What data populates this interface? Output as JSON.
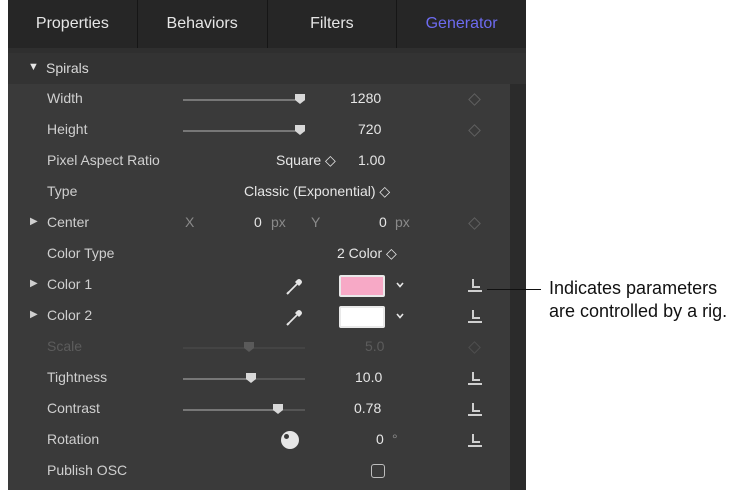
{
  "tabs": [
    {
      "label": "Properties",
      "active": false
    },
    {
      "label": "Behaviors",
      "active": false
    },
    {
      "label": "Filters",
      "active": false
    },
    {
      "label": "Generator",
      "active": true
    }
  ],
  "section": {
    "label": "Spirals",
    "expanded": true
  },
  "params": {
    "width": {
      "label": "Width",
      "value": "1280"
    },
    "height": {
      "label": "Height",
      "value": "720"
    },
    "par": {
      "label": "Pixel Aspect Ratio",
      "mode": "Square",
      "value": "1.00"
    },
    "type": {
      "label": "Type",
      "value": "Classic (Exponential)"
    },
    "center": {
      "label": "Center",
      "x_label": "X",
      "x_value": "0",
      "y_label": "Y",
      "y_value": "0",
      "unit": "px"
    },
    "color_type": {
      "label": "Color Type",
      "value": "2 Color"
    },
    "color1": {
      "label": "Color 1",
      "color": "#f7a9c6"
    },
    "color2": {
      "label": "Color 2",
      "color": "#ffffff"
    },
    "scale": {
      "label": "Scale",
      "value": "5.0",
      "disabled": true
    },
    "tightness": {
      "label": "Tightness",
      "value": "10.0"
    },
    "contrast": {
      "label": "Contrast",
      "value": "0.78"
    },
    "rotation": {
      "label": "Rotation",
      "value": "0",
      "unit": "°"
    },
    "publish_osc": {
      "label": "Publish OSC",
      "checked": false
    }
  },
  "updown_glyph": "◇",
  "callout": {
    "line1": "Indicates parameters",
    "line2": "are controlled by a rig."
  },
  "colors": {
    "accent": "#6d6bf0",
    "panel": "#3a3a3a",
    "tabbar": "#262626"
  },
  "icons": [
    "disclosure-triangle-icon",
    "keyframe-diamond-icon",
    "rig-icon",
    "eyedropper-icon",
    "chevron-down-icon",
    "rotation-dial-icon",
    "checkbox"
  ]
}
